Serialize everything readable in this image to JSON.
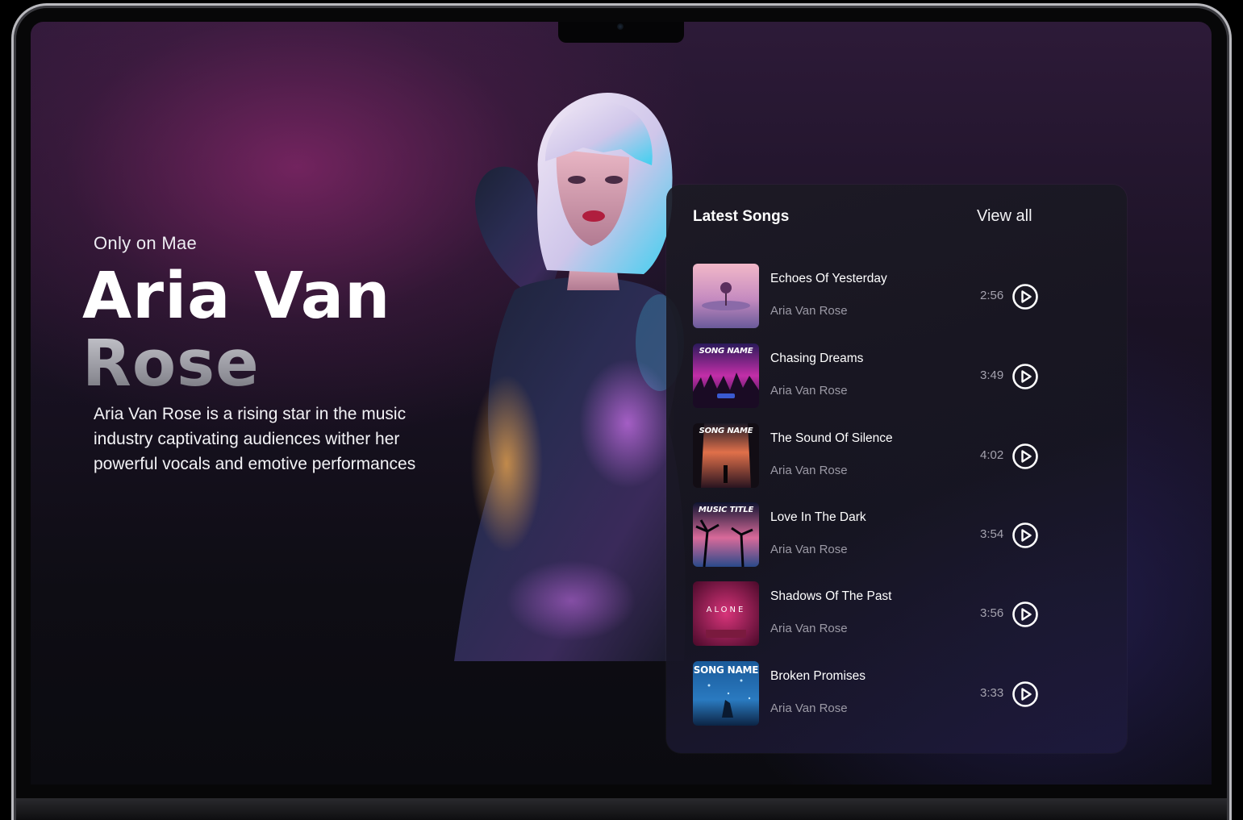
{
  "hero": {
    "eyebrow": "Only on Mae",
    "name_line_1": "Aria Van",
    "name_line_2": "Rose",
    "bio": "Aria Van Rose is a rising star in the music industry captivating audiences wither her powerful vocals and emotive performances"
  },
  "songs_panel": {
    "title": "Latest Songs",
    "view_all_label": "View all",
    "items": [
      {
        "title": "Echoes Of Yesterday",
        "artist": "Aria Van Rose",
        "duration": "2:56",
        "cover_text": ""
      },
      {
        "title": "Chasing Dreams",
        "artist": "Aria Van Rose",
        "duration": "3:49",
        "cover_text": "SONG NAME"
      },
      {
        "title": "The Sound Of Silence",
        "artist": "Aria Van Rose",
        "duration": "4:02",
        "cover_text": "SONG NAME"
      },
      {
        "title": "Love In The Dark",
        "artist": "Aria Van Rose",
        "duration": "3:54",
        "cover_text": "MUSIC TITLE"
      },
      {
        "title": "Shadows Of The Past",
        "artist": "Aria Van Rose",
        "duration": "3:56",
        "cover_text": "ALONE"
      },
      {
        "title": "Broken Promises",
        "artist": "Aria Van Rose",
        "duration": "3:33",
        "cover_text": "SONG NAME"
      }
    ]
  },
  "icons": {
    "play": "play-circle-icon"
  },
  "colors": {
    "accent_magenta": "#8c286e",
    "panel_bg": "#1c1a24",
    "text_primary": "#ffffff",
    "text_muted": "#9c9aa6"
  }
}
